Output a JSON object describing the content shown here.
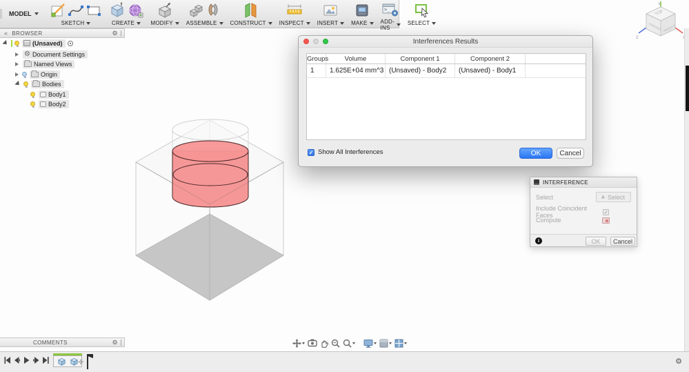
{
  "toolbar": {
    "model_label": "MODEL",
    "groups": [
      {
        "label": "SKETCH"
      },
      {
        "label": "CREATE"
      },
      {
        "label": "MODIFY"
      },
      {
        "label": "ASSEMBLE"
      },
      {
        "label": "CONSTRUCT"
      },
      {
        "label": "INSPECT"
      },
      {
        "label": "INSERT"
      },
      {
        "label": "MAKE"
      },
      {
        "label": "ADD-INS"
      },
      {
        "label": "SELECT"
      }
    ]
  },
  "viewcube": {
    "top": "TOP",
    "front": "FRONT",
    "right": "RIGHT",
    "axis_x": "X",
    "axis_y": "Y",
    "axis_z": "Z"
  },
  "browser": {
    "title": "BROWSER",
    "root_label": "(Unsaved)",
    "items": [
      {
        "label": "Document Settings"
      },
      {
        "label": "Named Views"
      },
      {
        "label": "Origin"
      },
      {
        "label": "Bodies"
      },
      {
        "label": "Body1"
      },
      {
        "label": "Body2"
      }
    ]
  },
  "dialog": {
    "title": "Interferences Results",
    "columns": [
      "Groups",
      "Volume",
      "Component 1",
      "Component 2"
    ],
    "row": {
      "group": "1",
      "volume": "1.625E+04 mm^3",
      "component1": "(Unsaved) - Body2",
      "component2": "(Unsaved) - Body1"
    },
    "show_all_label": "Show All Interferences",
    "ok_label": "OK",
    "cancel_label": "Cancel"
  },
  "palette": {
    "title": "INTERFERENCE",
    "select_label": "Select",
    "select_button_label": "Select",
    "include_coincident_label": "Include Coincident Faces",
    "compute_label": "Compute",
    "ok_label": "OK",
    "cancel_label": "Cancel"
  },
  "comments": {
    "title": "COMMENTS"
  },
  "icons": {
    "gear": "⚙",
    "check": "✓",
    "collapse": "«",
    "info": "i",
    "move": "✛"
  },
  "colors": {
    "interference_red": "#f58c8c",
    "bottom_face_gray": "#c6c6c6",
    "accent_blue": "#2f76f2",
    "timeline_green": "#8dc63f"
  }
}
